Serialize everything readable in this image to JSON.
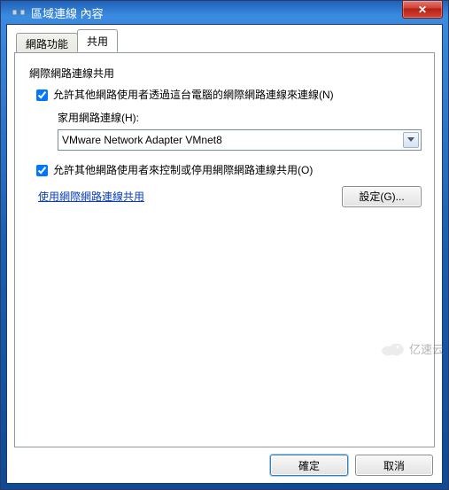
{
  "window": {
    "title": "區域連線 內容",
    "close_icon": "✕"
  },
  "tabs": {
    "items": [
      {
        "label": "網路功能",
        "active": false
      },
      {
        "label": "共用",
        "active": true
      }
    ]
  },
  "sharing": {
    "section_title": "網際網路連線共用",
    "allow_share": {
      "checked": true,
      "label": "允許其他網路使用者透過這台電腦的網際網路連線來連線(N)"
    },
    "home_connection": {
      "label": "家用網路連線(H):",
      "value": "VMware Network Adapter VMnet8"
    },
    "allow_control": {
      "checked": true,
      "label": "允許其他網路使用者來控制或停用網際網路連線共用(O)"
    },
    "link_text": "使用網際網路連線共用",
    "settings_button": "設定(G)..."
  },
  "buttons": {
    "ok": "確定",
    "cancel": "取消"
  },
  "watermark": "亿速云"
}
